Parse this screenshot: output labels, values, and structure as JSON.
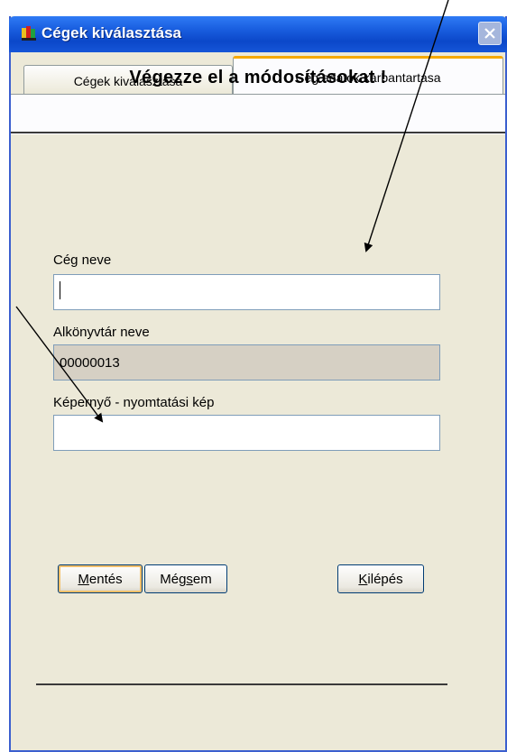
{
  "window": {
    "title": "Cégek kiválasztása",
    "icon": "app-icon"
  },
  "tabs": [
    {
      "label": "Cégek kiválasztása",
      "active": false
    },
    {
      "label": "Cég adatok karbantartása",
      "active": true
    }
  ],
  "heading": "Végezze el a módosításokat !",
  "fields": {
    "ceg_neve": {
      "label": "Cég neve",
      "value": ""
    },
    "alkonyvtar_neve": {
      "label": "Alkönyvtár neve",
      "value": "00000013"
    },
    "kepernyo": {
      "label": "Képernyő - nyomtatási kép",
      "value": ""
    }
  },
  "buttons": {
    "mentes": {
      "label": "Mentés",
      "mnemonic": "M",
      "rest": "entés"
    },
    "megsem": {
      "pre": "Még",
      "mnemonic": "s",
      "rest": "em"
    },
    "kilepes": {
      "mnemonic": "K",
      "rest": "ilépés"
    }
  },
  "colors": {
    "titlebar": "#0b47c9",
    "active_tab_accent": "#f6a900",
    "readonly_field": "#d6d0c4"
  }
}
